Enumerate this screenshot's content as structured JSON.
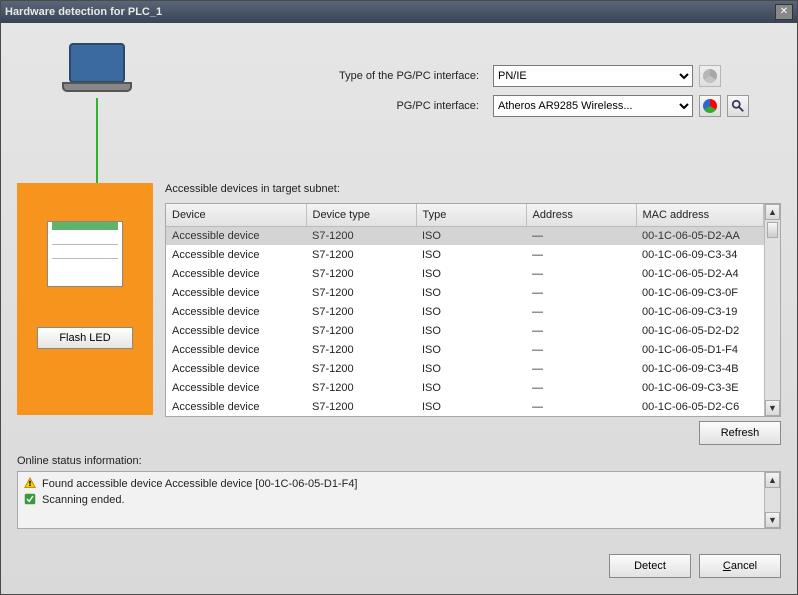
{
  "window": {
    "title": "Hardware detection for PLC_1"
  },
  "form": {
    "type_label": "Type of the PG/PC interface:",
    "type_value": "PN/IE",
    "iface_label": "PG/PC interface:",
    "iface_value": "Atheros AR9285 Wireless..."
  },
  "panel": {
    "flash_label": "Flash LED"
  },
  "table": {
    "caption": "Accessible devices in target subnet:",
    "headers": [
      "Device",
      "Device type",
      "Type",
      "Address",
      "MAC address"
    ],
    "rows": [
      {
        "device": "Accessible device",
        "dtype": "S7-1200",
        "type": "ISO",
        "addr": "—",
        "mac": "00-1C-06-05-D2-AA",
        "sel": true
      },
      {
        "device": "Accessible device",
        "dtype": "S7-1200",
        "type": "ISO",
        "addr": "—",
        "mac": "00-1C-06-09-C3-34"
      },
      {
        "device": "Accessible device",
        "dtype": "S7-1200",
        "type": "ISO",
        "addr": "—",
        "mac": "00-1C-06-05-D2-A4"
      },
      {
        "device": "Accessible device",
        "dtype": "S7-1200",
        "type": "ISO",
        "addr": "—",
        "mac": "00-1C-06-09-C3-0F"
      },
      {
        "device": "Accessible device",
        "dtype": "S7-1200",
        "type": "ISO",
        "addr": "—",
        "mac": "00-1C-06-09-C3-19"
      },
      {
        "device": "Accessible device",
        "dtype": "S7-1200",
        "type": "ISO",
        "addr": "—",
        "mac": "00-1C-06-05-D2-D2"
      },
      {
        "device": "Accessible device",
        "dtype": "S7-1200",
        "type": "ISO",
        "addr": "—",
        "mac": "00-1C-06-05-D1-F4"
      },
      {
        "device": "Accessible device",
        "dtype": "S7-1200",
        "type": "ISO",
        "addr": "—",
        "mac": "00-1C-06-09-C3-4B"
      },
      {
        "device": "Accessible device",
        "dtype": "S7-1200",
        "type": "ISO",
        "addr": "—",
        "mac": "00-1C-06-09-C3-3E"
      },
      {
        "device": "Accessible device",
        "dtype": "S7-1200",
        "type": "ISO",
        "addr": "—",
        "mac": "00-1C-06-05-D2-C6"
      }
    ]
  },
  "buttons": {
    "refresh": "Refresh",
    "detect": "Detect",
    "cancel": "Cancel"
  },
  "status": {
    "label": "Online status information:",
    "lines": [
      {
        "icon": "warn",
        "text": "Found accessible device Accessible device [00-1C-06-05-D1-F4]"
      },
      {
        "icon": "ok",
        "text": "Scanning ended."
      }
    ]
  }
}
